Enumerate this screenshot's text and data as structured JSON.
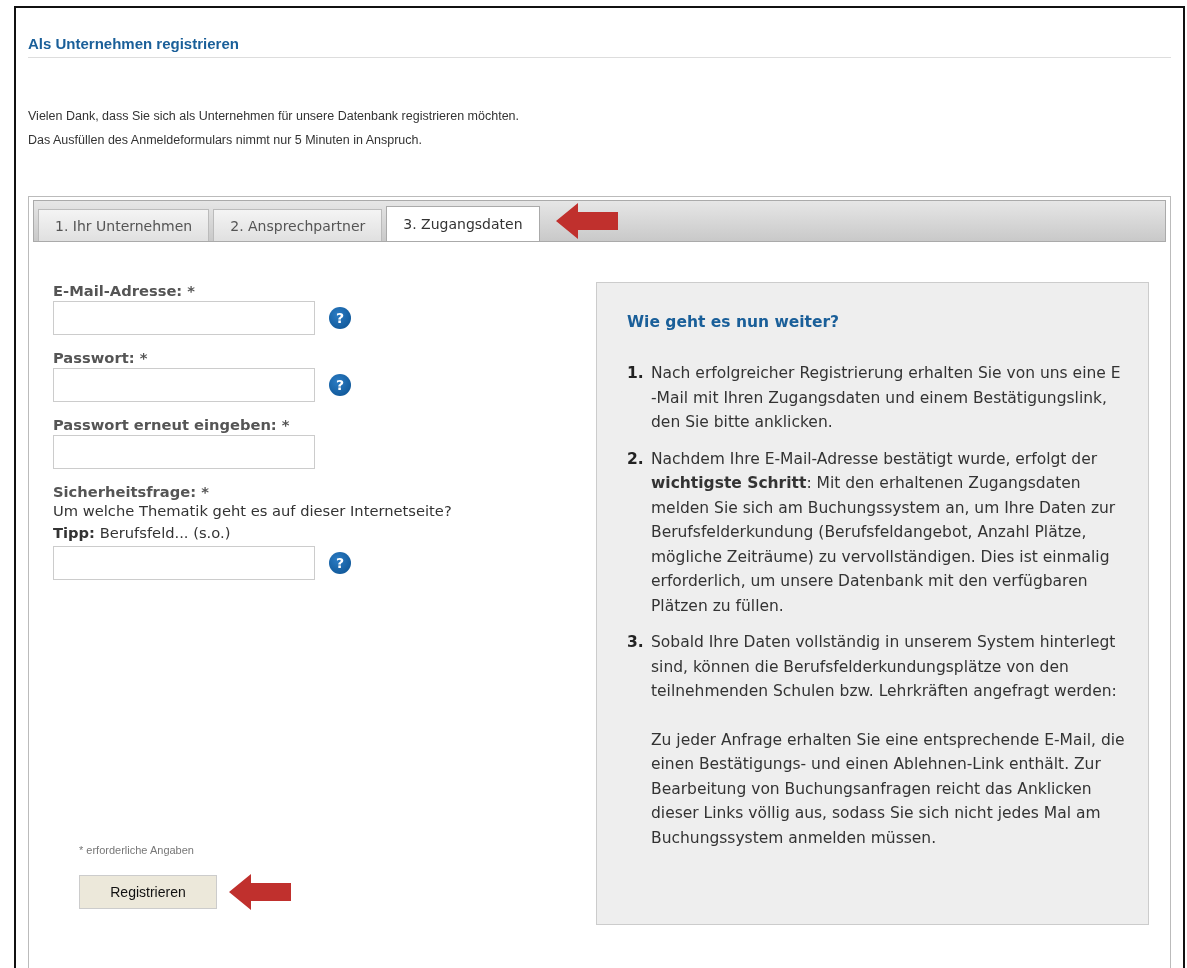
{
  "title": "Als Unternehmen registrieren",
  "intro": [
    "Vielen Dank, dass Sie sich als Unternehmen für unsere Datenbank registrieren möchten.",
    "Das Ausfüllen des Anmeldeformulars nimmt nur 5 Minuten in Anspruch."
  ],
  "tabs": [
    {
      "label": "1. Ihr Unternehmen",
      "selected": false
    },
    {
      "label": "2. Ansprechpartner",
      "selected": false
    },
    {
      "label": "3. Zugangsdaten",
      "selected": true
    }
  ],
  "fields": [
    {
      "label": "E-Mail-Adresse: *",
      "help": "?"
    },
    {
      "label": "Passwort: *",
      "help": "?"
    },
    {
      "label": "Passwort erneut eingeben: *"
    },
    {
      "label": "Sicherheitsfrage: *",
      "question": "Um welche Thematik geht es auf dieser Internetseite?",
      "hint": "**Tipp:** Berufsfeld... (s.o.)",
      "help": "?"
    }
  ],
  "footnote": "* erforderliche Angaben",
  "submit": "Registrieren",
  "info": {
    "title": "Wie geht es nun weiter?",
    "steps": [
      {
        "number": "1.",
        "paragraphs": [
          "Nach erfolgreicher Registrierung erhalten Sie von uns eine E -Mail mit Ihren Zugangsdaten und einem Bestätigungslink, den Sie bitte anklicken."
        ]
      },
      {
        "number": "2.",
        "paragraphs": [
          "Nachdem Ihre E-Mail-Adresse bestätigt wurde, erfolgt der **wichtigste Schritt**: Mit den erhaltenen Zugangsdaten melden Sie sich am Buchungssystem an, um Ihre Daten zur Berufsfelderkundung (Berufsfeldangebot, Anzahl Plätze, mögliche Zeiträume) zu vervollständigen. Dies ist einmalig erforderlich, um unsere Datenbank mit den verfügbaren Plätzen zu füllen."
        ]
      },
      {
        "number": "3.",
        "paragraphs": [
          "Sobald Ihre Daten vollständig in unserem System hinterlegt sind, können die Berufsfelderkundungsplätze von den teilnehmenden Schulen bzw. Lehrkräften angefragt werden:",
          "Zu jeder Anfrage erhalten Sie eine entsprechende E-Mail, die einen Bestätigungs- und einen Ablehnen-Link enthält. Zur Bearbeitung von Buchungsanfragen reicht das Anklicken dieser Links völlig aus, sodass Sie sich nicht jedes Mal am Buchungssystem anmelden müssen."
        ]
      }
    ]
  }
}
